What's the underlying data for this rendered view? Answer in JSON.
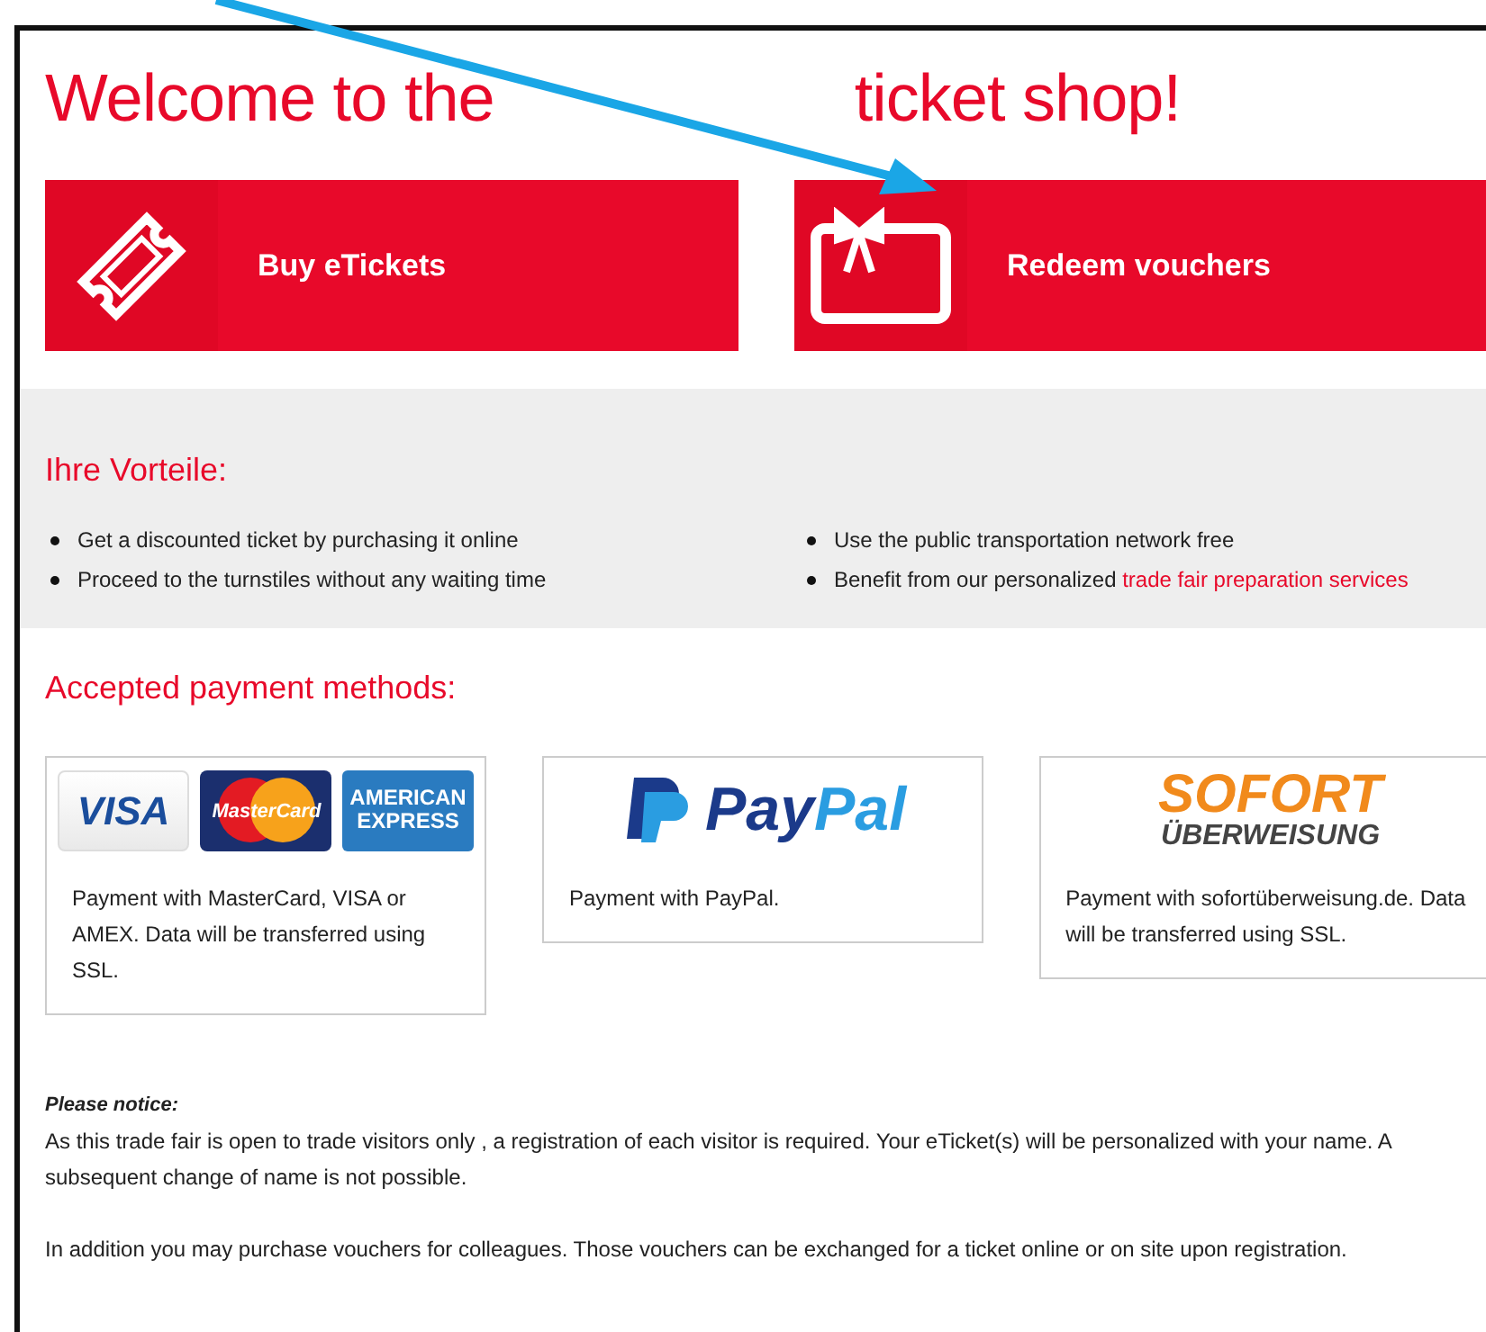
{
  "title": {
    "before": "Welcome to the",
    "after": "ticket shop!"
  },
  "actions": [
    {
      "kind": "ticket",
      "label": "Buy eTickets"
    },
    {
      "kind": "gift",
      "label": "Redeem vouchers"
    }
  ],
  "benefits": {
    "heading": "Ihre Vorteile:",
    "items": [
      {
        "text": "Get a discounted ticket by purchasing it online"
      },
      {
        "text": "Use the public transportation network free"
      },
      {
        "text": "Proceed to the turnstiles without any waiting time"
      },
      {
        "text": "Benefit from our personalized",
        "link": "trade fair preparation services"
      }
    ]
  },
  "payment": {
    "heading": "Accepted payment methods:",
    "methods": [
      {
        "logos": [
          {
            "kind": "visa",
            "text": "VISA"
          },
          {
            "kind": "mastercard",
            "text": "MasterCard"
          },
          {
            "kind": "amex",
            "text": "AMERICAN",
            "text2": "EXPRESS"
          }
        ],
        "description": "Payment with MasterCard, VISA or AMEX. Data will be transferred using SSL."
      },
      {
        "logos": [
          {
            "kind": "paypal",
            "text": "PayPal"
          }
        ],
        "description": "Payment with PayPal."
      },
      {
        "logos": [
          {
            "kind": "sofort",
            "text": "SOFORT",
            "text2": "ÜBERWEISUNG"
          }
        ],
        "description": "Payment with sofortüberweisung.de. Data will be transferred using SSL."
      }
    ]
  },
  "notice": {
    "heading": "Please notice:",
    "paragraphs": [
      "As this trade fair is open to trade visitors only , a registration of each visitor is required. Your eTicket(s) will be personalized with your name. A subsequent change of name is not possible.",
      "In addition you may purchase vouchers for colleagues. Those vouchers can be exchanged for a ticket online or on site upon registration."
    ]
  }
}
